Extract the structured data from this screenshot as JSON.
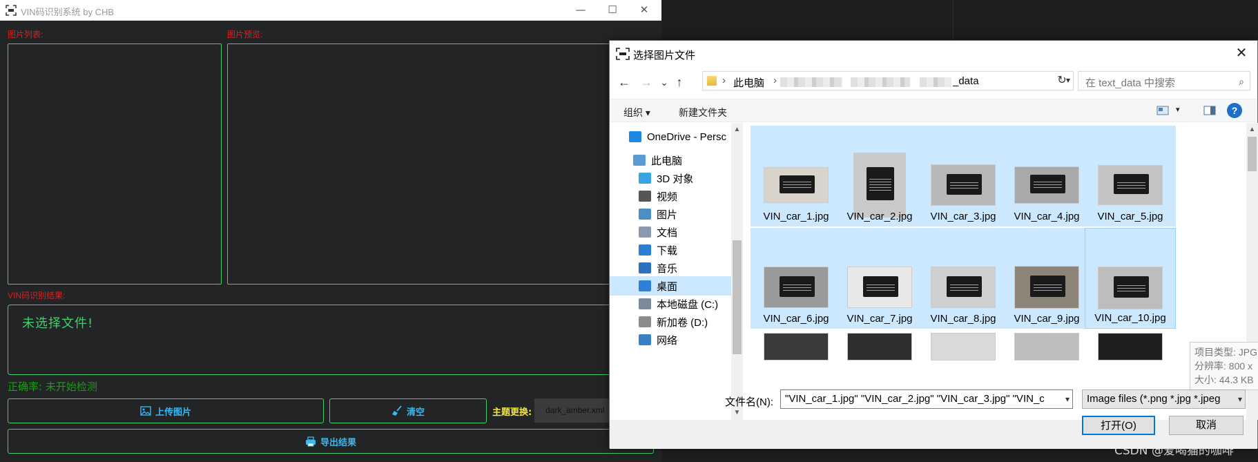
{
  "app": {
    "title": "VIN码识别系统 by CHB",
    "image_list_label": "图片列表:",
    "image_preview_label": "图片预览:",
    "result_label": "VIN码识别结果:",
    "result_text": "未选择文件!",
    "accuracy": "正确率: 未开始检测",
    "upload_button": "上传图片",
    "clear_button": "清空",
    "export_button": "导出结果",
    "theme_label": "主题更换:",
    "theme_value": "dark_amber.xml",
    "window_controls": {
      "minimize": "—",
      "maximize": "☐",
      "close": "✕"
    }
  },
  "dialog": {
    "title": "选择图片文件",
    "close": "✕",
    "nav": {
      "back": "←",
      "forward": "→",
      "recent": "⌄",
      "up": "↑"
    },
    "address": {
      "root": "此电脑",
      "last": "_data"
    },
    "search_placeholder": "在 text_data 中搜索",
    "toolbar": {
      "organize": "组织 ▾",
      "new_folder": "新建文件夹",
      "help": "?"
    },
    "tree": [
      {
        "label": "OneDrive - Persc",
        "icon_color": "#1e88e5",
        "icon": "cloud-icon"
      },
      {
        "label": "此电脑",
        "icon_color": "#5b9bd5",
        "icon": "computer-icon"
      },
      {
        "label": "3D 对象",
        "icon_color": "#3aa3e3",
        "icon": "cube-icon"
      },
      {
        "label": "视频",
        "icon_color": "#555555",
        "icon": "video-icon"
      },
      {
        "label": "图片",
        "icon_color": "#4a90c8",
        "icon": "picture-icon"
      },
      {
        "label": "文档",
        "icon_color": "#8a9bb0",
        "icon": "document-icon"
      },
      {
        "label": "下载",
        "icon_color": "#2a7fd4",
        "icon": "download-icon"
      },
      {
        "label": "音乐",
        "icon_color": "#2f6fbf",
        "icon": "music-icon"
      },
      {
        "label": "桌面",
        "icon_color": "#2f7fd8",
        "icon": "desktop-icon"
      },
      {
        "label": "本地磁盘 (C:)",
        "icon_color": "#7a8a99",
        "icon": "drive-icon"
      },
      {
        "label": "新加卷 (D:)",
        "icon_color": "#8c8c8c",
        "icon": "drive-icon"
      },
      {
        "label": "网络",
        "icon_color": "#3c7fc4",
        "icon": "network-icon"
      }
    ],
    "files": [
      {
        "name": "VIN_car_1.jpg"
      },
      {
        "name": "VIN_car_2.jpg"
      },
      {
        "name": "VIN_car_3.jpg"
      },
      {
        "name": "VIN_car_4.jpg"
      },
      {
        "name": "VIN_car_5.jpg"
      },
      {
        "name": "VIN_car_6.jpg"
      },
      {
        "name": "VIN_car_7.jpg"
      },
      {
        "name": "VIN_car_8.jpg"
      },
      {
        "name": "VIN_car_9.jpg"
      },
      {
        "name": "VIN_car_10.jpg"
      }
    ],
    "tooltip": {
      "type": "项目类型: JPG",
      "resolution": "分辨率: 800 x",
      "size": "大小: 44.3 KB"
    },
    "filename_label": "文件名(N):",
    "filename_value": "\"VIN_car_1.jpg\" \"VIN_car_2.jpg\" \"VIN_car_3.jpg\" \"VIN_c",
    "filetype_value": "Image files (*.png *.jpg *.jpeg",
    "open_button": "打开(O)",
    "cancel_button": "取消"
  },
  "watermark": "CSDN @爱喝猫的咖啡"
}
